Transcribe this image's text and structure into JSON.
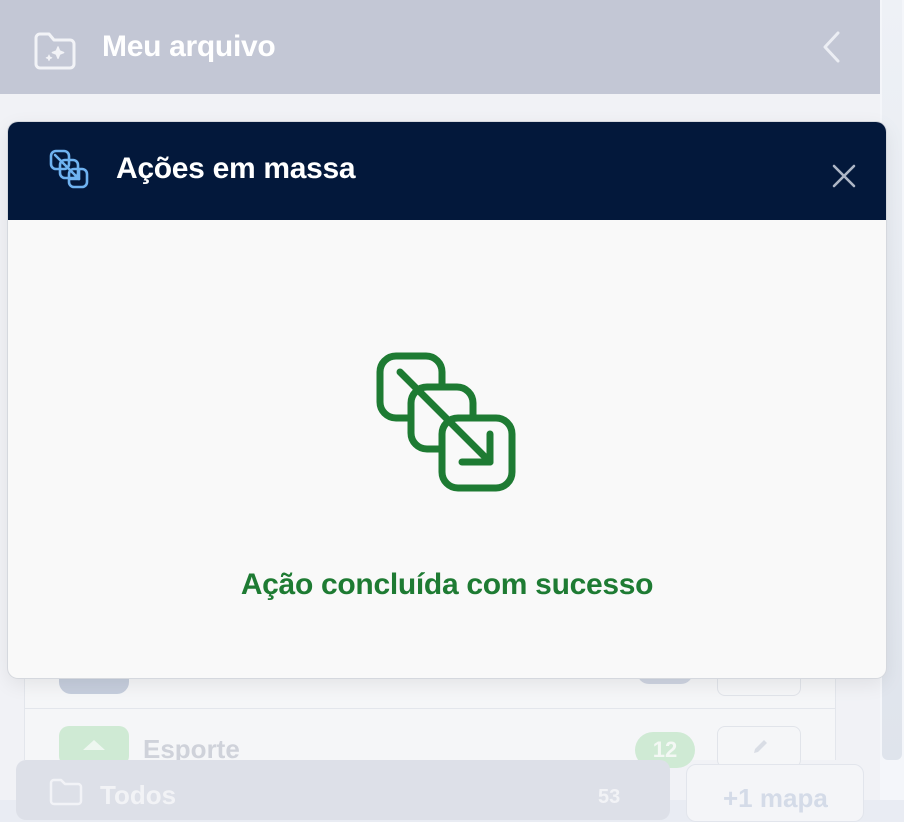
{
  "background": {
    "header_title": "Meu arquivo",
    "list": {
      "row_label": "Esporte",
      "row_count": "12"
    },
    "footer": {
      "all_label": "Todos",
      "all_count": "53",
      "add_map_label": "+1 mapa"
    }
  },
  "modal": {
    "title": "Ações em massa",
    "success_message": "Ação concluída com sucesso"
  },
  "colors": {
    "modal_header_bg": "#03183b",
    "success_green": "#1e7b33",
    "header_bg_dimmed": "#c3c7d5"
  },
  "icons": {
    "header": "folder-sparkle-icon",
    "back": "chevron-left-icon",
    "modal": "bulk-actions-icon",
    "close": "close-icon",
    "success": "bulk-actions-success-icon"
  }
}
